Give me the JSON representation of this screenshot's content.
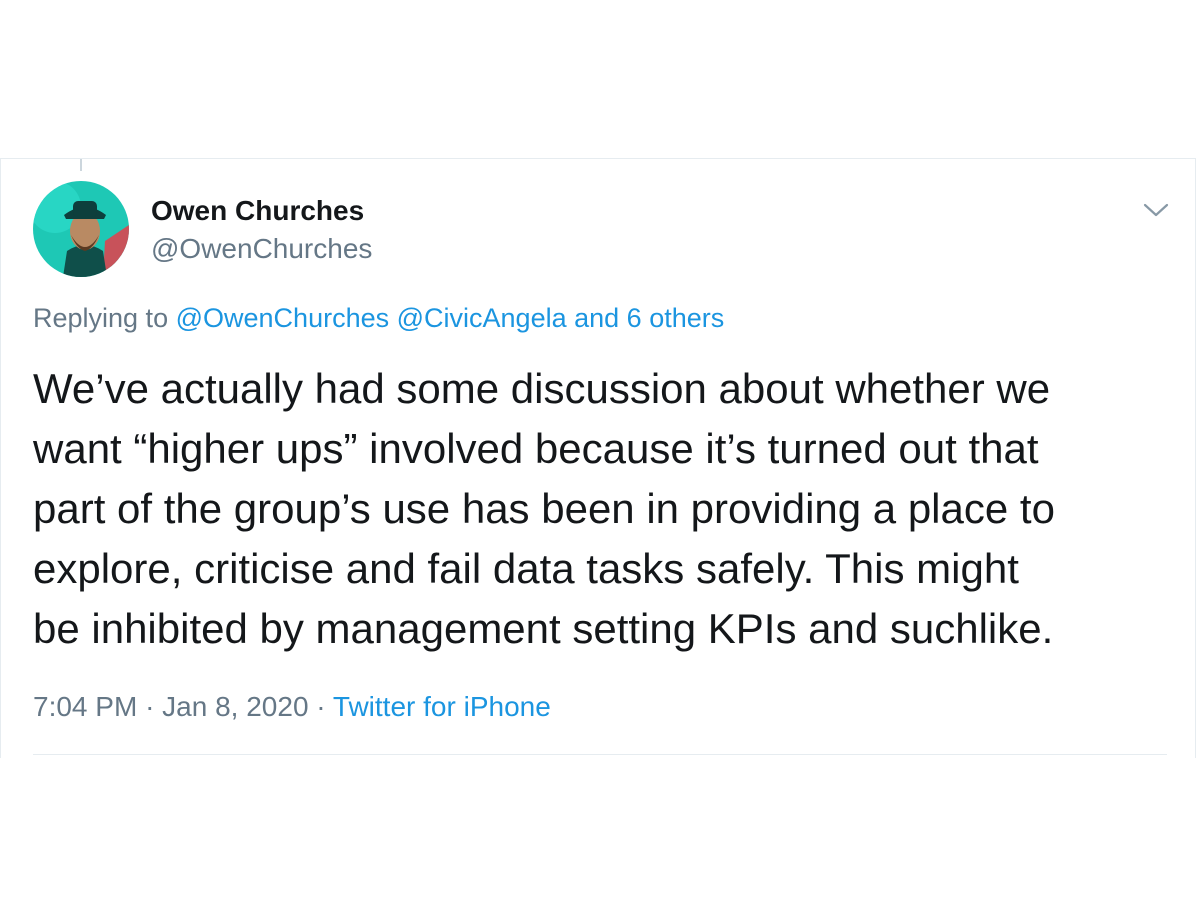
{
  "tweet": {
    "author": {
      "name": "Owen Churches",
      "handle": "@OwenChurches"
    },
    "reply_context": {
      "prefix": "Replying to",
      "mentions": [
        "@OwenChurches",
        "@CivicAngela"
      ],
      "others": "and 6 others"
    },
    "text": "We’ve actually had some discussion about whether we\nwant  “higher ups” involved because it’s turned out that\npart of the group’s use has been in providing a place to\nexplore, criticise and fail data tasks safely. This might\nbe inhibited by management setting KPIs and suchlike.",
    "time": "7:04 PM",
    "separator": "·",
    "date": "Jan 8, 2020",
    "source": "Twitter for iPhone"
  },
  "icons": {
    "avatar": "profile-photo",
    "menu": "chevron-down-icon"
  },
  "colors": {
    "link": "#1b95e0",
    "secondary_text": "#657786",
    "primary_text": "#14171a",
    "avatar_bg": "#1ec8b5"
  }
}
